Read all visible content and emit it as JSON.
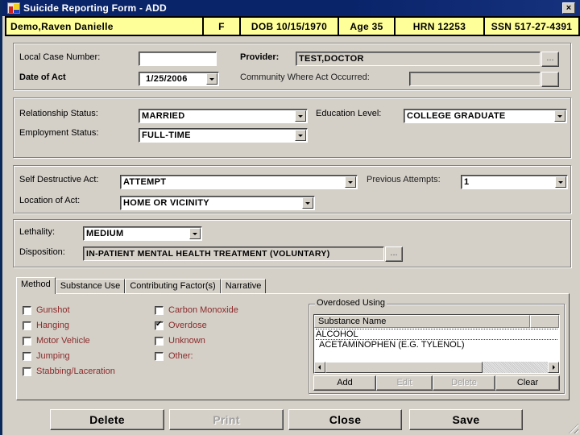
{
  "window": {
    "title": "Suicide Reporting Form - ADD",
    "close_label": "×"
  },
  "patient": {
    "name": "Demo,Raven Danielle",
    "sex": "F",
    "dob": "DOB 10/15/1970",
    "age": "Age 35",
    "hrn": "HRN 12253",
    "ssn": "SSN 517-27-4391"
  },
  "case": {
    "local_case_label": "Local Case Number:",
    "local_case_value": "",
    "date_label": "Date of Act",
    "date_value": "1/25/2006",
    "provider_label": "Provider:",
    "provider_value": "TEST,DOCTOR",
    "provider_lookup_label": "...",
    "community_label": "Community Where Act Occurred:",
    "community_value": "",
    "community_lookup_label": ""
  },
  "demographics": {
    "relationship_label": "Relationship Status:",
    "relationship_value": "MARRIED",
    "employment_label": "Employment Status:",
    "employment_value": "FULL-TIME",
    "education_label": "Education Level:",
    "education_value": "COLLEGE GRADUATE"
  },
  "act": {
    "self_destructive_label": "Self Destructive Act:",
    "self_destructive_value": "ATTEMPT",
    "previous_attempts_label": "Previous Attempts:",
    "previous_attempts_value": "1",
    "location_label": "Location of Act:",
    "location_value": "HOME OR VICINITY"
  },
  "outcome": {
    "lethality_label": "Lethality:",
    "lethality_value": "MEDIUM",
    "disposition_label": "Disposition:",
    "disposition_value": "IN-PATIENT MENTAL HEALTH TREATMENT (VOLUNTARY)",
    "disposition_lookup_label": "..."
  },
  "tabs": [
    {
      "label": "Method",
      "active": true
    },
    {
      "label": "Substance Use",
      "active": false
    },
    {
      "label": "Contributing Factor(s)",
      "active": false
    },
    {
      "label": "Narrative",
      "active": false
    }
  ],
  "method": {
    "options": [
      {
        "label": "Gunshot",
        "checked": false
      },
      {
        "label": "Hanging",
        "checked": false
      },
      {
        "label": "Motor Vehicle",
        "checked": false
      },
      {
        "label": "Jumping",
        "checked": false
      },
      {
        "label": "Stabbing/Laceration",
        "checked": false
      },
      {
        "label": "Carbon Monoxide",
        "checked": false
      },
      {
        "label": "Overdose",
        "checked": true
      },
      {
        "label": "Unknown",
        "checked": false
      },
      {
        "label": "Other:",
        "checked": false
      }
    ],
    "label_color": "#8b2a2a"
  },
  "overdose": {
    "group_label": "Overdosed Using",
    "column_header": "Substance Name",
    "substances": [
      "ALCOHOL",
      "ACETAMINOPHEN (E.G. TYLENOL)"
    ],
    "buttons": {
      "add": "Add",
      "edit": "Edit",
      "delete": "Delete",
      "clear": "Clear"
    }
  },
  "footer": {
    "delete": "Delete",
    "print": "Print",
    "close": "Close",
    "save": "Save"
  },
  "colors": {
    "titlebar": "#0a246a",
    "patient_bar": "#ffff99",
    "window_bg": "#d4d0c8",
    "desktop": "#0a2a5c"
  }
}
